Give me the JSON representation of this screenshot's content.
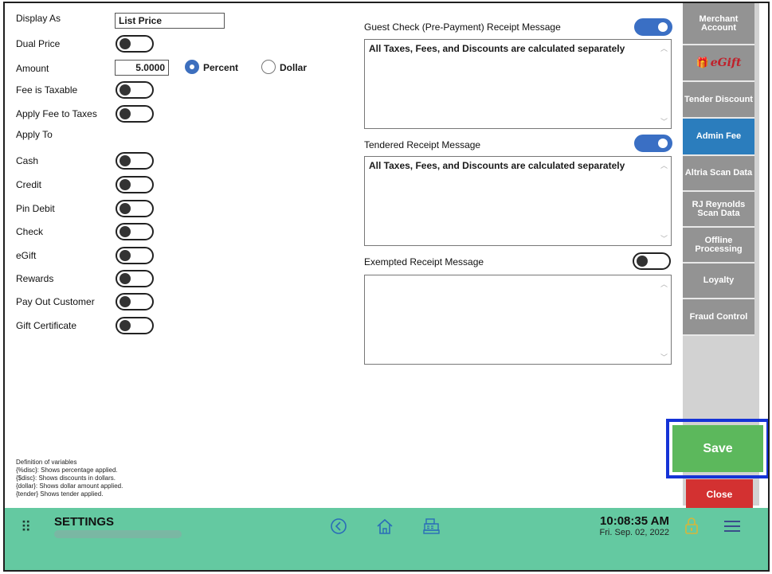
{
  "left": {
    "display_as_label": "Display As",
    "display_as_value": "List Price",
    "dual_price_label": "Dual Price",
    "amount_label": "Amount",
    "amount_value": "5.0000",
    "percent_label": "Percent",
    "dollar_label": "Dollar",
    "fee_taxable_label": "Fee is Taxable",
    "apply_fee_taxes_label": "Apply Fee to Taxes",
    "apply_to_label": "Apply To",
    "apply_items": [
      "Cash",
      "Credit",
      "Pin Debit",
      "Check",
      "eGift",
      "Rewards",
      "Pay Out Customer",
      "Gift Certificate"
    ]
  },
  "variables": {
    "title": "Definition of variables",
    "lines": [
      "{%disc}: Shows percentage applied.",
      "{$disc}:  Shows discounts in dollars.",
      "{dollar}: Shows dollar amount applied.",
      "{tender} Shows tender applied."
    ]
  },
  "messages": {
    "guest_title": "Guest Check (Pre-Payment) Receipt Message",
    "guest_text": "All Taxes, Fees, and Discounts are calculated separately",
    "tendered_title": "Tendered Receipt Message",
    "tendered_text": "All Taxes, Fees, and Discounts are calculated separately",
    "exempted_title": "Exempted Receipt Message",
    "exempted_text": ""
  },
  "tabs": {
    "merchant": "Merchant Account",
    "egift": "eGift",
    "tender_discount": "Tender Discount",
    "admin_fee": "Admin Fee",
    "altria": "Altria Scan Data",
    "rj": "RJ Reynolds Scan Data",
    "offline": "Offline Processing",
    "loyalty": "Loyalty",
    "fraud": "Fraud Control"
  },
  "buttons": {
    "save": "Save",
    "close": "Close"
  },
  "footer": {
    "title": "SETTINGS",
    "time": "10:08:35 AM",
    "date": "Fri. Sep. 02, 2022"
  },
  "colors": {
    "accent": "#3a6fc4",
    "footer": "#64c9a1",
    "save": "#5cb85c",
    "close": "#d33131",
    "active_tab": "#2b7dbd"
  }
}
